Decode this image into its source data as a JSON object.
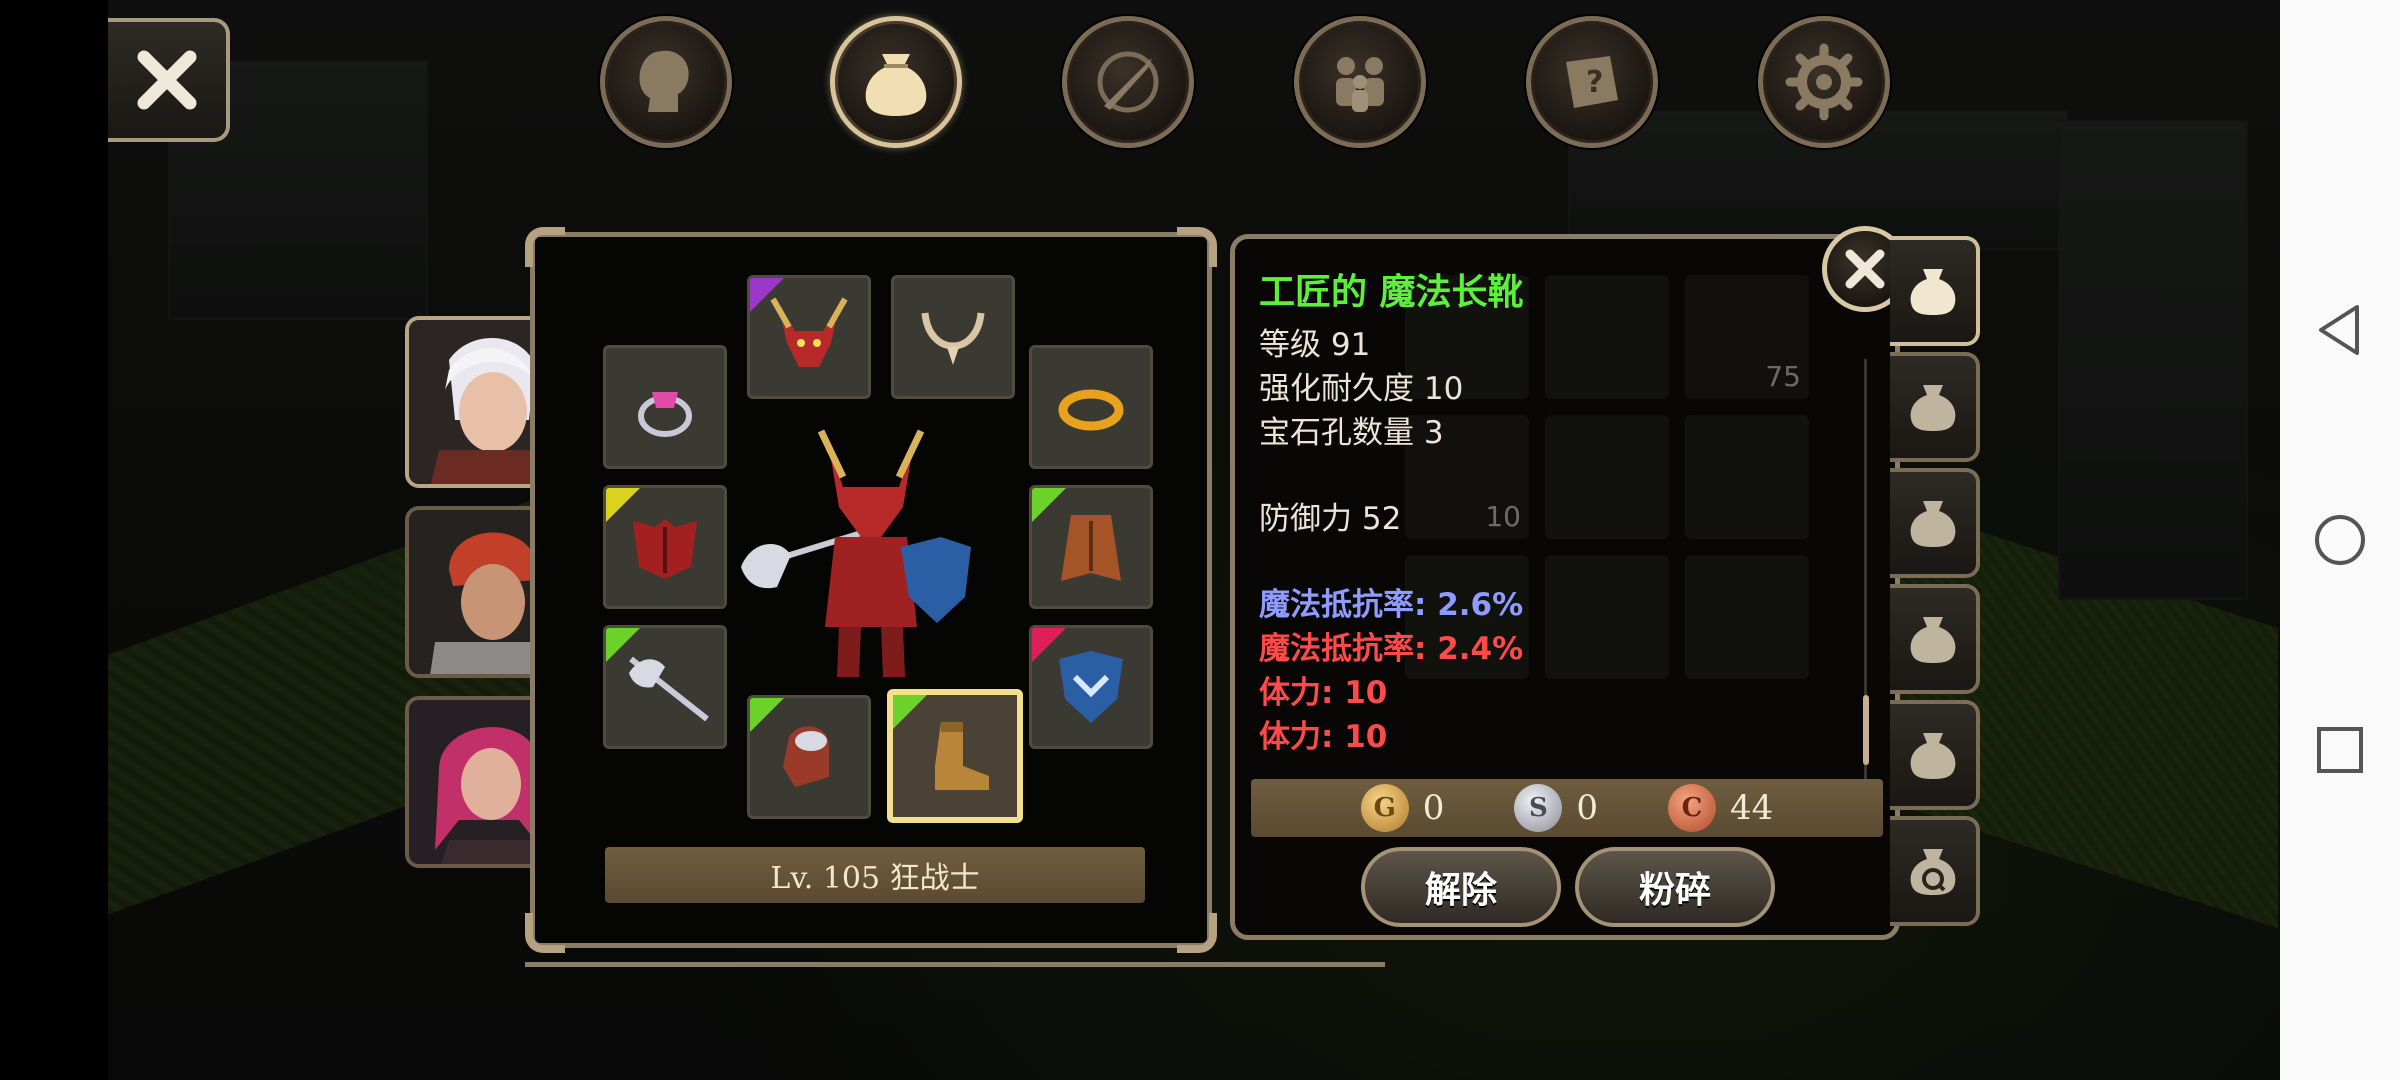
{
  "top_tabs": [
    {
      "name": "character",
      "icon": "head-silhouette-icon"
    },
    {
      "name": "inventory",
      "icon": "bag-icon",
      "active": true
    },
    {
      "name": "skills",
      "icon": "sword-compass-icon"
    },
    {
      "name": "party",
      "icon": "group-icon"
    },
    {
      "name": "quest",
      "icon": "scroll-icon"
    },
    {
      "name": "settings",
      "icon": "gear-icon"
    }
  ],
  "equipment": {
    "level_label": "Lv. 105 狂战士"
  },
  "item": {
    "name": "工匠的 魔法长靴",
    "level": "等级 91",
    "durability": "强化耐久度 10",
    "sockets": "宝石孔数量 3",
    "defense": "防御力 52",
    "magic_resist_1": "魔法抵抗率: 2.6%",
    "magic_resist_2": "魔法抵抗率: 2.4%",
    "stamina_1": "体力: 10",
    "stamina_2": "体力: 10"
  },
  "currency": {
    "gold_symbol": "G",
    "gold": "0",
    "silver_symbol": "S",
    "silver": "0",
    "copper_symbol": "C",
    "copper": "44"
  },
  "actions": {
    "unequip": "解除",
    "shatter": "粉碎"
  },
  "bag_counts": {
    "slot_a": "75",
    "slot_b": "10"
  },
  "colors": {
    "item_name": "#5df03a",
    "stat_blue": "#8f9cff",
    "stat_red": "#ff4a4a",
    "frame": "#8b7c66",
    "highlight": "#f2e08a"
  }
}
